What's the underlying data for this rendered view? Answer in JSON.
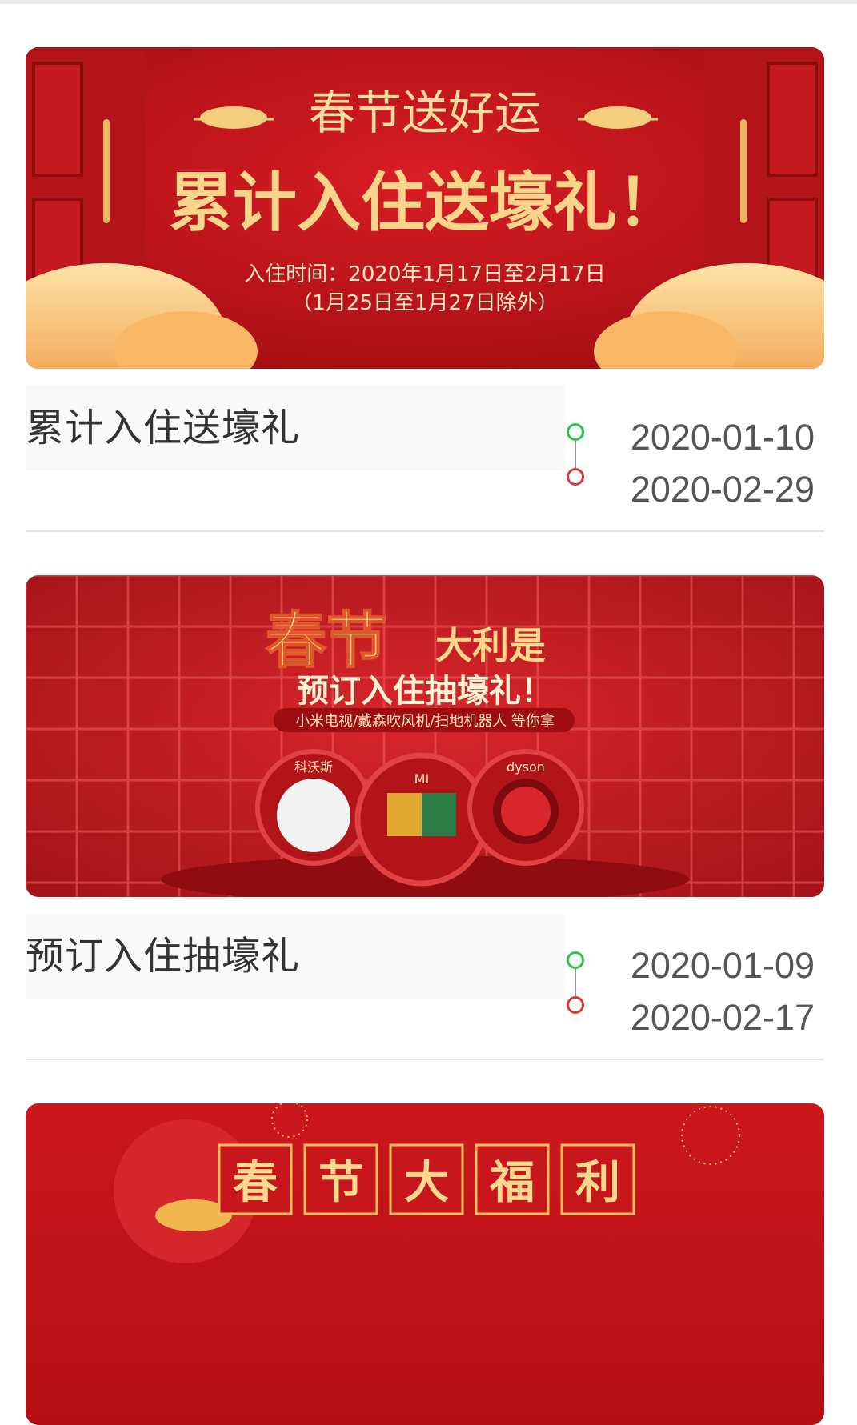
{
  "activities": [
    {
      "title": "累计入住送壕礼",
      "start_date": "2020-01-10",
      "end_date": "2020-02-29",
      "banner": {
        "headline": "春节送好运",
        "main_text": "累计入住送壕礼！",
        "period_line": "入住时间：2020年1月17日至2月17日",
        "exclusion_line": "（1月25日至1月27日除外）"
      }
    },
    {
      "title": "预订入住抽壕礼",
      "start_date": "2020-01-09",
      "end_date": "2020-02-17",
      "banner": {
        "headline_big": "春节",
        "headline_small": "大利是",
        "main_text": "预订入住抽壕礼！",
        "prize_line": "小米电视/戴森吹风机/扫地机器人 等你拿",
        "prize_1": "科沃斯",
        "prize_2": "MI",
        "prize_3": "dyson"
      }
    },
    {
      "banner": {
        "chars": [
          "春",
          "节",
          "大",
          "福",
          "利"
        ]
      }
    }
  ],
  "colors": {
    "banner_red": "#c8161d",
    "gold": "#f7d58b",
    "start_dot": "#2ec44a",
    "end_dot": "#d43b3b"
  }
}
